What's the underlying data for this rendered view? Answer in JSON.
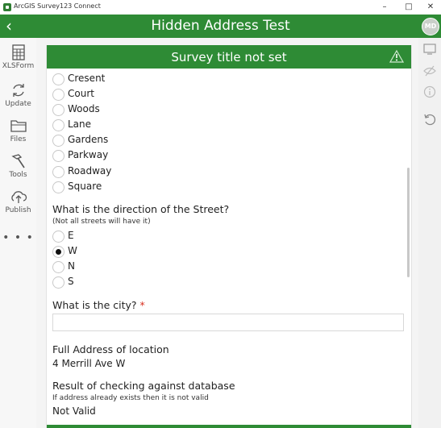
{
  "window": {
    "app_title": "ArcGIS Survey123 Connect",
    "minimize": "–",
    "maximize": "□",
    "close": "✕"
  },
  "header": {
    "title": "Hidden Address Test",
    "avatar_initials": "MD"
  },
  "left_toolbar": {
    "items": [
      {
        "label": "XLSForm",
        "icon": "spreadsheet-icon"
      },
      {
        "label": "Update",
        "icon": "refresh-icon"
      },
      {
        "label": "Files",
        "icon": "folder-icon"
      },
      {
        "label": "Tools",
        "icon": "hammer-icon"
      },
      {
        "label": "Publish",
        "icon": "cloud-upload-icon"
      }
    ],
    "more": "• • •"
  },
  "survey": {
    "title": "Survey title not set",
    "street_type_options": [
      "Cresent",
      "Court",
      "Woods",
      "Lane",
      "Gardens",
      "Parkway",
      "Roadway",
      "Square"
    ],
    "direction": {
      "label": "What is the direction of the Street?",
      "hint": "(Not all streets will have it)",
      "options": [
        "E",
        "W",
        "N",
        "S"
      ],
      "selected": "W"
    },
    "city": {
      "label": "What is the city?",
      "required_mark": "*",
      "value": ""
    },
    "full_address": {
      "label": "Full Address of location",
      "value": "4 Merrill Ave W"
    },
    "check": {
      "label": "Result of checking against database",
      "hint": "If address already exists then it is not valid",
      "value": "Not Valid"
    }
  },
  "colors": {
    "brand_green": "#2e8b35"
  }
}
